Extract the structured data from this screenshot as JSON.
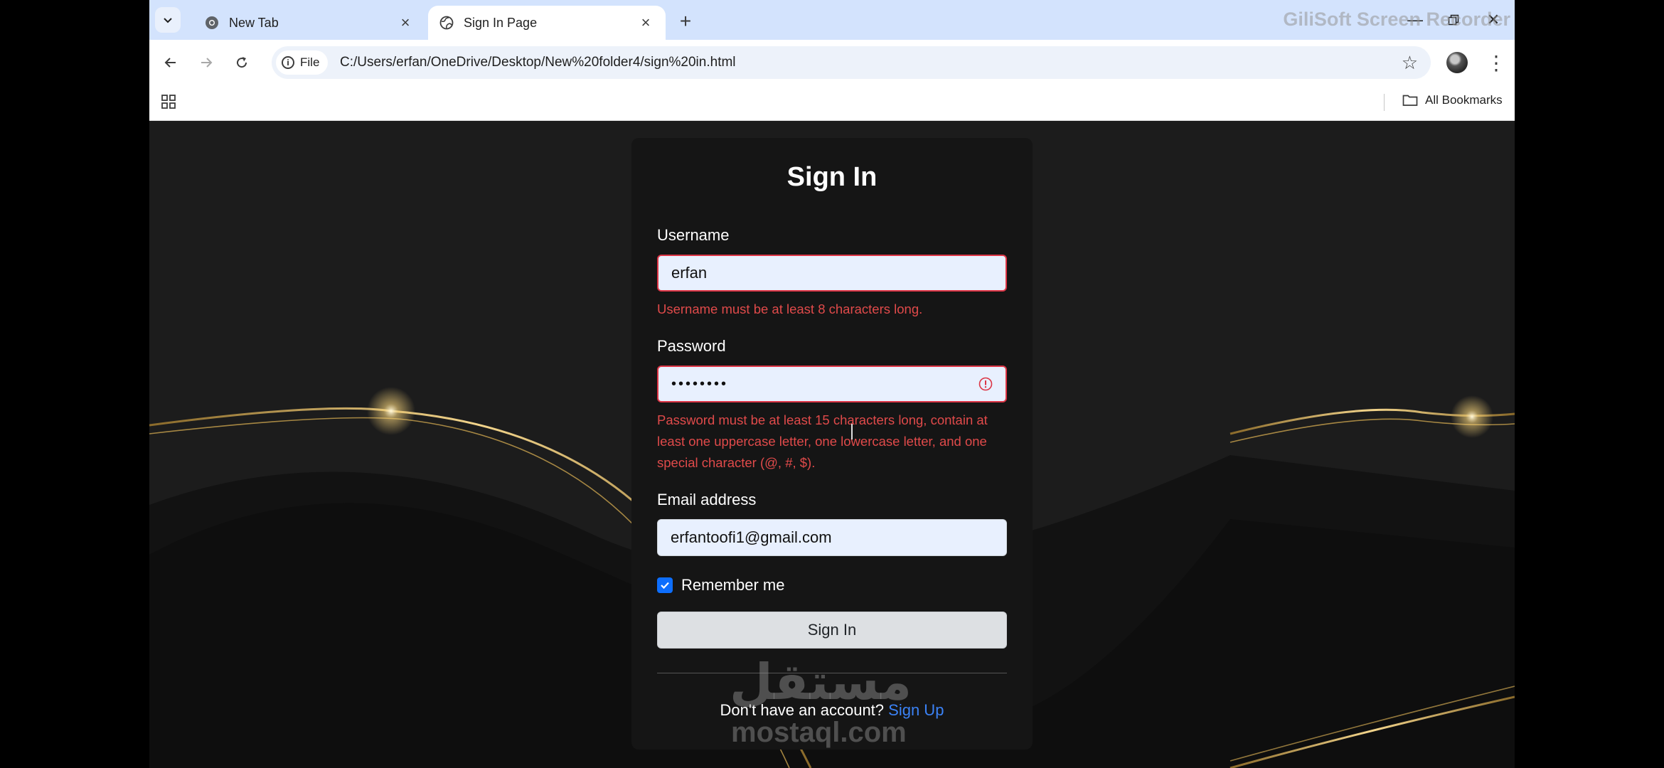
{
  "tabs": [
    {
      "title": "New Tab",
      "active": false
    },
    {
      "title": "Sign In Page",
      "active": true
    }
  ],
  "recorder_watermark": "GiliSoft Screen Recorder",
  "toolbar": {
    "site_chip": "File",
    "url": "C:/Users/erfan/OneDrive/Desktop/New%20folder4/sign%20in.html"
  },
  "bookmarks": {
    "all_label": "All Bookmarks"
  },
  "form": {
    "title": "Sign In",
    "username": {
      "label": "Username",
      "value": "erfan",
      "error": "Username must be at least 8 characters long."
    },
    "password": {
      "label": "Password",
      "value": "••••••••",
      "error": "Password must be at least 15 characters long, contain at least one uppercase letter, one lowercase letter, and one special character (@, #, $)."
    },
    "email": {
      "label": "Email address",
      "value": "erfantoofi1@gmail.com"
    },
    "remember": {
      "label": "Remember me",
      "checked": true
    },
    "submit_label": "Sign In",
    "footer_text": "Don't have an account?",
    "footer_link": "Sign Up"
  },
  "watermark": {
    "arabic": "مستقل",
    "latin": "mostaql.com"
  },
  "colors": {
    "tabstrip": "#d3e3fd",
    "error": "#dc3545",
    "accent": "#0d6efd",
    "link": "#3b82f6",
    "card": "#151515"
  }
}
